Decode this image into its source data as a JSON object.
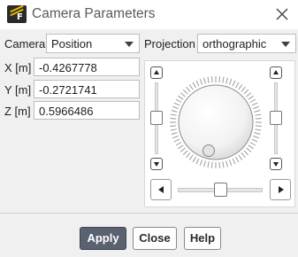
{
  "window": {
    "title": "Camera Parameters"
  },
  "camera": {
    "label": "Camera",
    "selected": "Position"
  },
  "projection": {
    "label": "Projection",
    "selected": "orthographic"
  },
  "fields": [
    {
      "label": "X [m]",
      "value": "-0.4267778"
    },
    {
      "label": "Y [m]",
      "value": "-0.2721741"
    },
    {
      "label": "Z [m]",
      "value": "0.5966486"
    }
  ],
  "footer": {
    "apply": "Apply",
    "close": "Close",
    "help": "Help"
  },
  "icons": {
    "app": "ansys-fluent-icon",
    "close": "close-icon",
    "scroll_up": "triangle-up-icon",
    "scroll_down": "triangle-down-icon",
    "scroll_left": "triangle-left-icon",
    "scroll_right": "triangle-right-icon"
  },
  "colors": {
    "primary_button": "#5a6170",
    "window_bg": "#f0f0f0"
  }
}
